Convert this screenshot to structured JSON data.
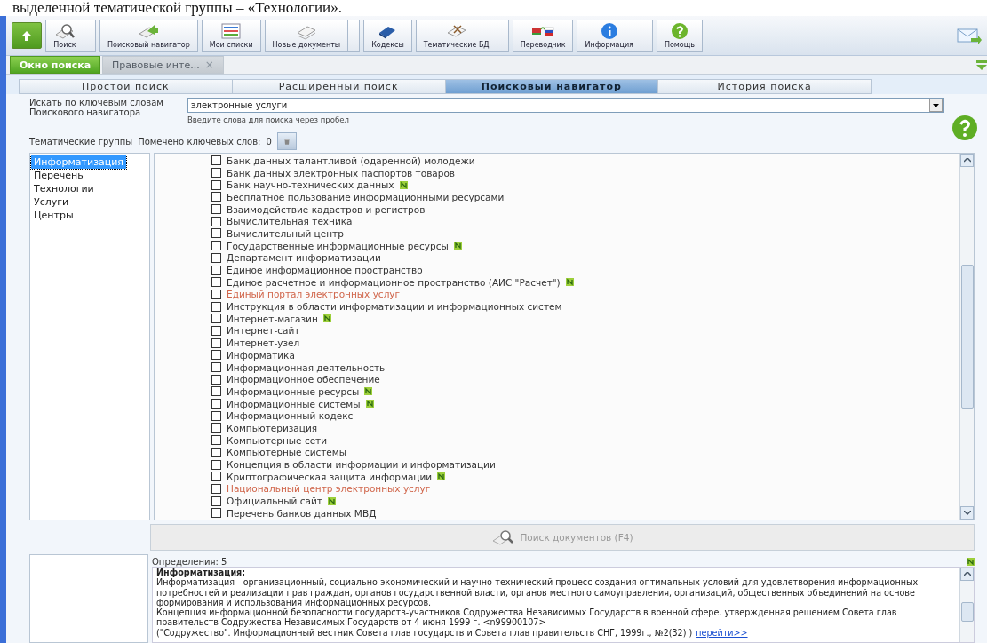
{
  "caption": "выделенной тематической группы – «Технологии».",
  "toolbar": {
    "buttons": [
      {
        "label": "Поиск",
        "kind": "magnifier",
        "dropdown": true
      },
      {
        "label": "Поисковый навигатор",
        "kind": "navigator",
        "dropdown": false
      },
      {
        "label": "Мои списки",
        "kind": "list",
        "dropdown": false
      },
      {
        "label": "Новые документы",
        "kind": "documents",
        "dropdown": true
      },
      {
        "label": "Кодексы",
        "kind": "book",
        "dropdown": false
      },
      {
        "label": "Тематические БД",
        "kind": "thematic",
        "dropdown": true
      },
      {
        "label": "Переводчик",
        "kind": "flags",
        "dropdown": false
      },
      {
        "label": "Информация",
        "kind": "info",
        "dropdown": true
      },
      {
        "label": "Помощь",
        "kind": "help",
        "dropdown": false
      }
    ]
  },
  "window_tabs": [
    {
      "label": "Окно поиска",
      "selected": true
    },
    {
      "label": "Правовые инте...",
      "selected": false,
      "close": "×"
    }
  ],
  "search_tabs": [
    {
      "label": "Простой поиск",
      "selected": false
    },
    {
      "label": "Расширенный поиск",
      "selected": false
    },
    {
      "label": "Поисковый навигатор",
      "selected": true
    },
    {
      "label": "История поиска",
      "selected": false
    }
  ],
  "keyword_label": "Искать по ключевым словам Поискового навигатора",
  "keyword_field": {
    "value": "электронные услуги",
    "hint": "Введите слова для поиска через пробел"
  },
  "groups_label": "Тематические группы",
  "marked_label": "Помечено ключевых слов:",
  "marked_count": "0",
  "groups": [
    {
      "label": "Информатизация",
      "selected": true
    },
    {
      "label": "Перечень",
      "selected": false
    },
    {
      "label": "Технологии",
      "selected": false
    },
    {
      "label": "Услуги",
      "selected": false
    },
    {
      "label": "Центры",
      "selected": false
    }
  ],
  "keywords": [
    {
      "text": "Банк данных талантливой (одаренной) молодежи",
      "checked": false,
      "has_docs": false,
      "highlighted": false
    },
    {
      "text": "Банк данных электронных паспортов товаров",
      "checked": false,
      "has_docs": false,
      "highlighted": false
    },
    {
      "text": "Банк научно-технических данных",
      "checked": false,
      "has_docs": true,
      "highlighted": false
    },
    {
      "text": "Бесплатное пользование информационными ресурсами",
      "checked": false,
      "has_docs": false,
      "highlighted": false
    },
    {
      "text": "Взаимодействие кадастров и регистров",
      "checked": false,
      "has_docs": false,
      "highlighted": false
    },
    {
      "text": "Вычислительная техника",
      "checked": false,
      "has_docs": false,
      "highlighted": false
    },
    {
      "text": "Вычислительный центр",
      "checked": false,
      "has_docs": false,
      "highlighted": false
    },
    {
      "text": "Государственные информационные ресурсы",
      "checked": false,
      "has_docs": true,
      "highlighted": false
    },
    {
      "text": "Департамент информатизации",
      "checked": false,
      "has_docs": false,
      "highlighted": false
    },
    {
      "text": "Единое информационное пространство",
      "checked": false,
      "has_docs": false,
      "highlighted": false
    },
    {
      "text": "Единое расчетное и информационное пространство (АИС \"Расчет\")",
      "checked": false,
      "has_docs": true,
      "highlighted": false
    },
    {
      "text": "Единый портал электронных услуг",
      "checked": false,
      "has_docs": false,
      "highlighted": true
    },
    {
      "text": "Инструкция в области информатизации и информационных систем",
      "checked": false,
      "has_docs": false,
      "highlighted": false
    },
    {
      "text": "Интернет-магазин",
      "checked": false,
      "has_docs": true,
      "highlighted": false
    },
    {
      "text": "Интернет-сайт",
      "checked": false,
      "has_docs": false,
      "highlighted": false
    },
    {
      "text": "Интернет-узел",
      "checked": false,
      "has_docs": false,
      "highlighted": false
    },
    {
      "text": "Информатика",
      "checked": false,
      "has_docs": false,
      "highlighted": false
    },
    {
      "text": "Информационная деятельность",
      "checked": false,
      "has_docs": false,
      "highlighted": false
    },
    {
      "text": "Информационное обеспечение",
      "checked": false,
      "has_docs": false,
      "highlighted": false
    },
    {
      "text": "Информационные ресурсы",
      "checked": false,
      "has_docs": true,
      "highlighted": false
    },
    {
      "text": "Информационные системы",
      "checked": false,
      "has_docs": true,
      "highlighted": false
    },
    {
      "text": "Информационный кодекс",
      "checked": false,
      "has_docs": false,
      "highlighted": false
    },
    {
      "text": "Компьютеризация",
      "checked": false,
      "has_docs": false,
      "highlighted": false
    },
    {
      "text": "Компьютерные сети",
      "checked": false,
      "has_docs": false,
      "highlighted": false
    },
    {
      "text": "Компьютерные системы",
      "checked": false,
      "has_docs": false,
      "highlighted": false
    },
    {
      "text": "Концепция в области информации и информатизации",
      "checked": false,
      "has_docs": false,
      "highlighted": false
    },
    {
      "text": "Криптографическая защита информации",
      "checked": false,
      "has_docs": true,
      "highlighted": false
    },
    {
      "text": "Национальный центр электронных услуг",
      "checked": false,
      "has_docs": false,
      "highlighted": true
    },
    {
      "text": "Официальный сайт",
      "checked": false,
      "has_docs": true,
      "highlighted": false
    },
    {
      "text": "Перечень банков данных МВД",
      "checked": false,
      "has_docs": false,
      "highlighted": false
    }
  ],
  "search_button": "Поиск документов (F4)",
  "definitions": {
    "count_label": "Определения: 5",
    "title": "Информатизация:",
    "paragraphs": [
      "Информатизация - организационный, социально-экономический и научно-технический процесс создания оптимальных условий для удовлетворения информационных потребностей и реализации прав граждан, органов государственной власти, органов местного самоуправления, организаций, общественных объединений на основе формирования и использования информационных ресурсов.",
      "Концепция информационной безопасности государств-участников Содружества Независимых Государств в военной сфере, утвержденная решением Совета глав правительств Содружества Независимых Государств от 4 июня 1999 г. <n99900107>"
    ],
    "citation": "(\"Содружество\". Информационный вестник Совета глав государств и Совета глав правительств СНГ, 1999г., №2(32) )",
    "link": "перейти>>"
  }
}
